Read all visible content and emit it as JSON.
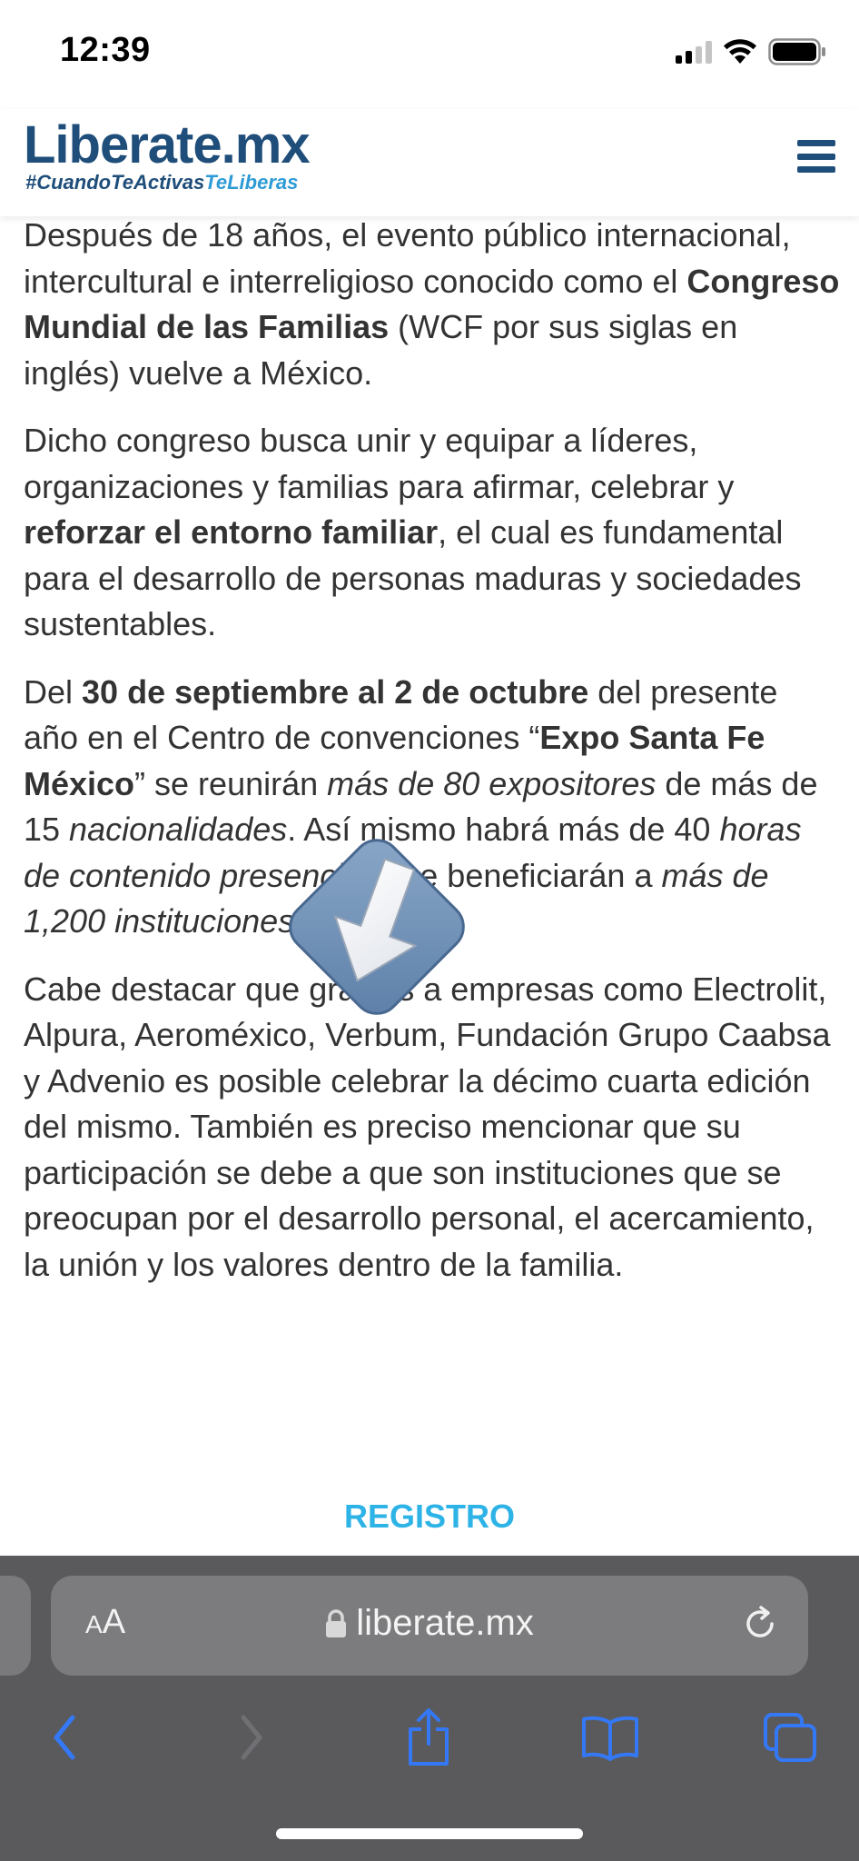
{
  "status_bar": {
    "time": "12:39"
  },
  "header": {
    "logo": "Liberate.mx",
    "tagline_part1": "#CuandoTeActivas",
    "tagline_part2": "TeLiberas",
    "menu_icon": "hamburger-menu-icon"
  },
  "article": {
    "p1": {
      "t1": "Después de 18 años, el evento público internacional, intercultural e interreligioso conocido como el ",
      "b1": "Congreso Mundial de las Familias",
      "t2": " (WCF por sus siglas en inglés) vuelve a México."
    },
    "p2": {
      "t1": "Dicho congreso busca unir y equipar a líderes, organizaciones y familias para afirmar, celebrar y ",
      "b1": "reforzar el entorno familiar",
      "t2": ", el cual es fundamental para el desarrollo de personas maduras y sociedades sustentables."
    },
    "p3": {
      "t1": "Del ",
      "b1": "30 de septiembre al 2 de octubre",
      "t2": " del presente año en el Centro de convenciones “",
      "b2": "Expo Santa Fe México",
      "t3": "” se reunirán ",
      "i1": "más de 80 expositores",
      "t4": " de más de 15 ",
      "i2": "nacionalidades",
      "t5": ". Así mismo habrá más de 40 ",
      "i3": "horas de contenido presencial",
      "t6": " y se beneficiarán a ",
      "i4": "más de 1,200 instituciones",
      "t7": "."
    },
    "p4": "Cabe destacar que gracias a empresas como Electrolit, Alpura, Aeroméxico, Verbum, Fundación Grupo Caabsa y Advenio es posible celebrar la décimo cuarta edición  del mismo. También es preciso mencionar que su participación se debe a que son instituciones que se preocupan por el desarrollo personal, el acercamiento, la unión y los valores dentro de la familia."
  },
  "register_link": "REGISTRO",
  "overlay": {
    "icon": "download-arrow-icon"
  },
  "browser": {
    "aa_small": "A",
    "aa_big": "A",
    "url": "liberate.mx",
    "icons": [
      "lock-icon",
      "reload-icon",
      "back-icon",
      "forward-icon",
      "share-icon",
      "bookmarks-icon",
      "tabs-icon"
    ]
  },
  "colors": {
    "brand_dark": "#1f4e7a",
    "brand_light": "#2e9bd6",
    "link": "#2eb3e6",
    "toolbar_bg": "#5a5a5c",
    "toolbar_icon": "#3478f6"
  }
}
